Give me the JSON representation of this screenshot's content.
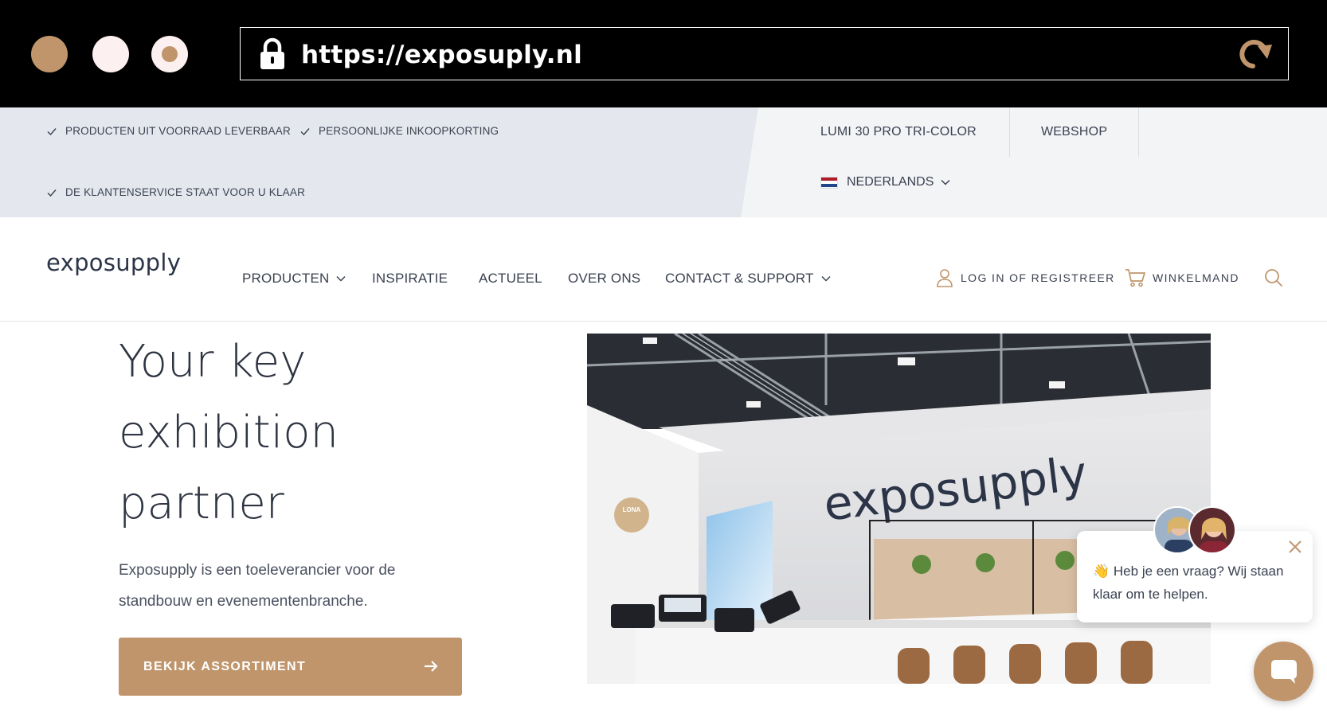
{
  "browser": {
    "url": "https://exposuply.nl"
  },
  "infobar": {
    "usps": [
      "PRODUCTEN UIT VOORRAAD LEVERBAAR",
      "PERSOONLIJKE INKOOPKORTING",
      "DE KLANTENSERVICE STAAT VOOR U KLAAR"
    ],
    "links": [
      "LUMI 30 PRO TRI-COLOR",
      "WEBSHOP"
    ],
    "language": "NEDERLANDS"
  },
  "header": {
    "logo": "exposupply",
    "nav": [
      "PRODUCTEN",
      "INSPIRATIE",
      "ACTUEEL",
      "OVER ONS",
      "CONTACT & SUPPORT"
    ],
    "login": "LOG IN OF REGISTREER",
    "cart": "WINKELMAND"
  },
  "hero": {
    "title_lines": [
      "Your key",
      "exhibition",
      "partner"
    ],
    "description": "Exposupply is een toeleverancier voor de standbouw en evenementenbranche.",
    "cta": "BEKIJK ASSORTIMENT",
    "image_logo": "exposupply",
    "image_badge": "LONA"
  },
  "chat": {
    "message": "Heb je een vraag? Wij staan klaar om te helpen."
  },
  "colors": {
    "accent": "#c0956b",
    "text_dark": "#2e3442",
    "infobar_left": "#e4e8ee",
    "infobar_right": "#f3f4f6"
  },
  "icons": [
    "lock-icon",
    "reload-icon",
    "check-icon",
    "chevron-down-icon",
    "user-icon",
    "cart-icon",
    "search-icon",
    "arrow-right-icon",
    "close-icon",
    "chat-icon",
    "waving-hand-icon"
  ]
}
